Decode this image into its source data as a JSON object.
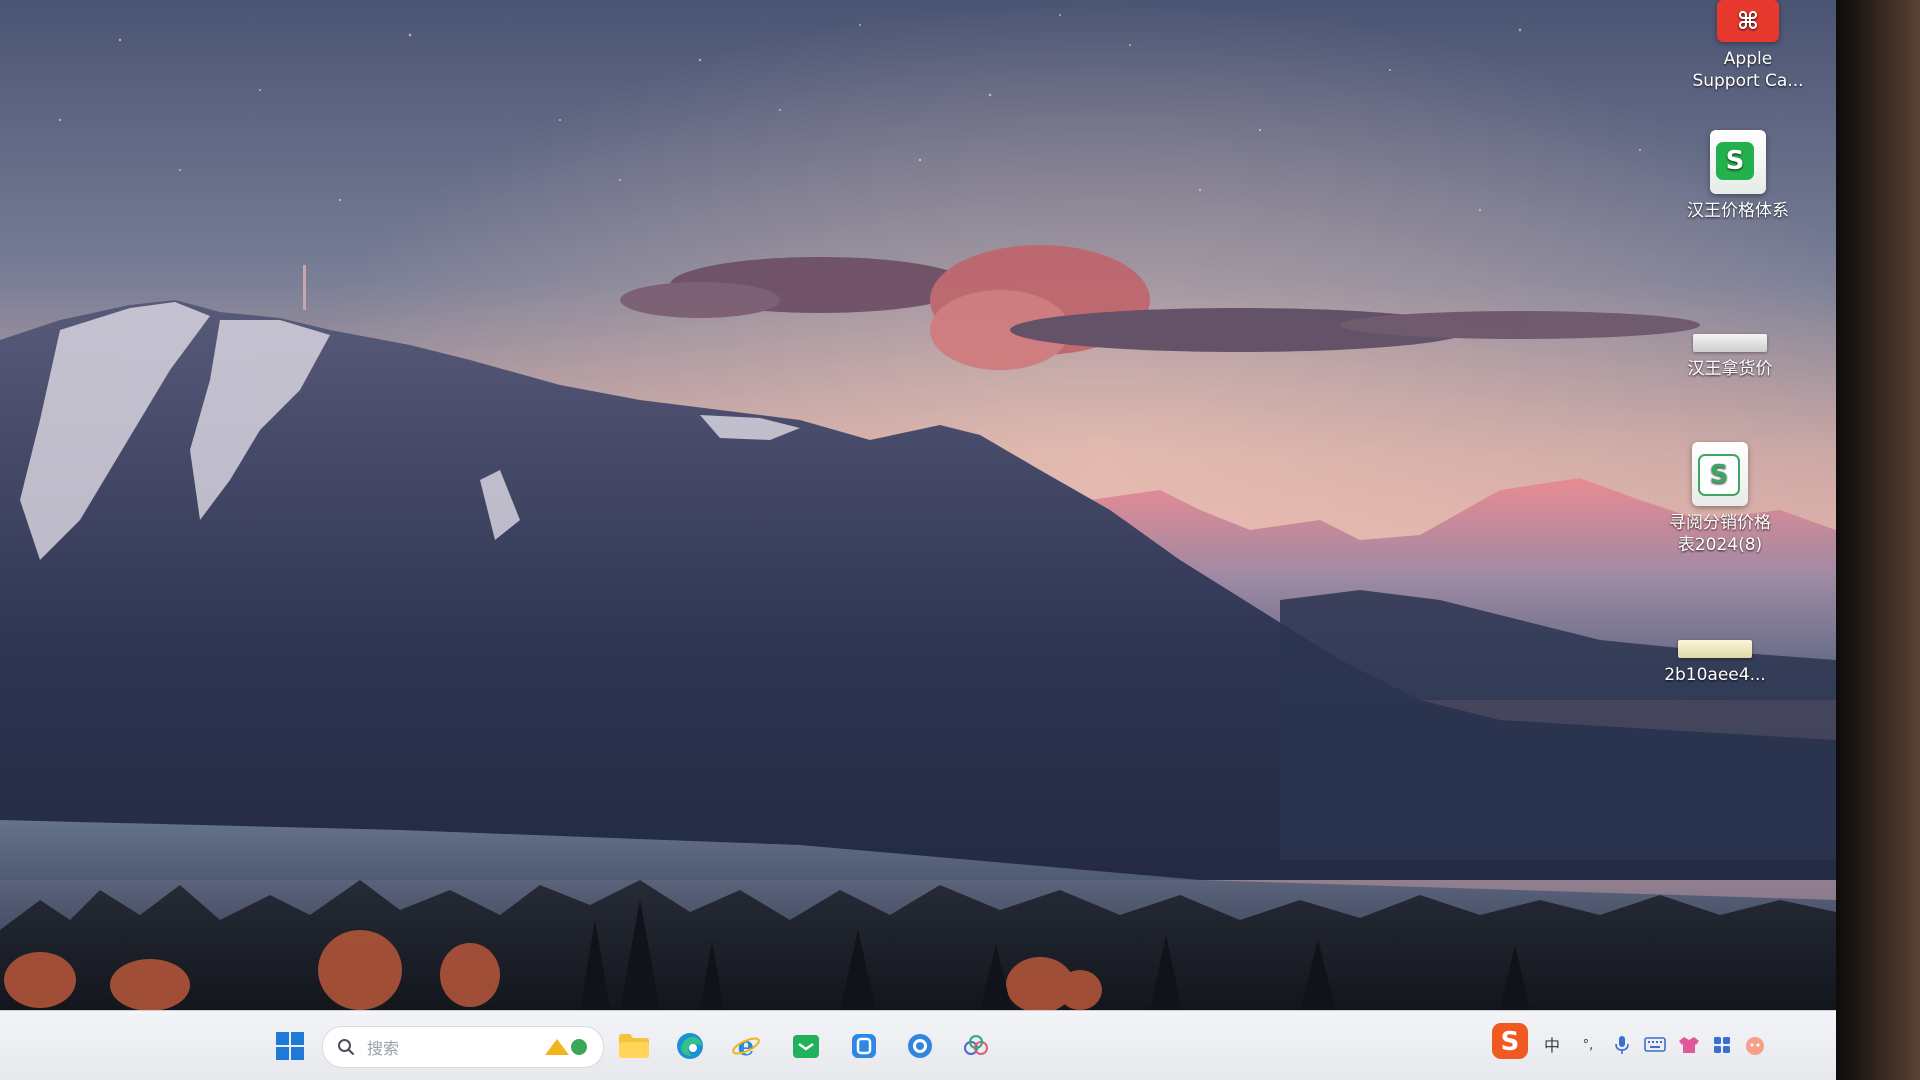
{
  "desktop": {
    "icons": [
      {
        "label": "Apple\nSupport Ca...",
        "icon": "app-red-icon"
      },
      {
        "label": "汉王价格体系",
        "icon": "wps-sheet-icon"
      },
      {
        "label": "汉王拿货价",
        "icon": "image-thumbnail-icon"
      },
      {
        "label": "寻阅分销价格\n表2024(8)",
        "icon": "wps-sheet-icon"
      },
      {
        "label": "2b10aee4...",
        "icon": "image-thumbnail-icon"
      }
    ]
  },
  "taskbar": {
    "search_placeholder": "搜索",
    "tray": {
      "ime_language": "中",
      "ime_punct": "°,"
    }
  },
  "colors": {
    "taskbar_bg": "#eceef2",
    "sogou_orange": "#f05a22",
    "wps_green": "#23b14d",
    "windows_blue": "#1e7ad6"
  }
}
